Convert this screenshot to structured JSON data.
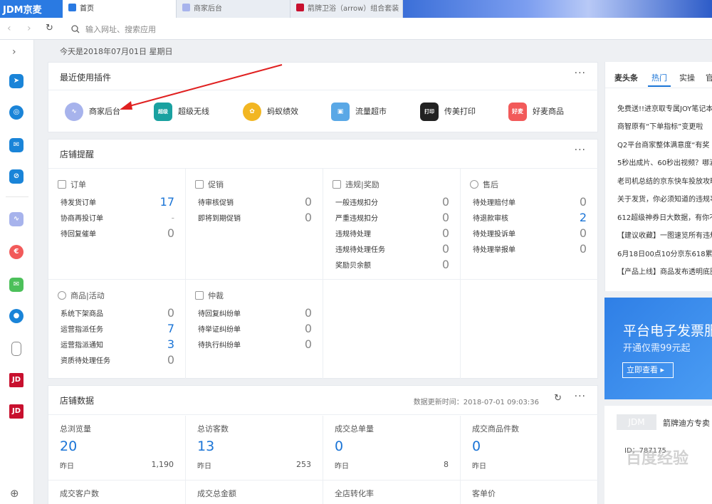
{
  "tabs": {
    "logo": "JDM京麦",
    "items": [
      {
        "label": "首页"
      },
      {
        "label": "商家后台"
      },
      {
        "label": "箭牌卫浴（arrow）组合套装"
      }
    ]
  },
  "address": {
    "placeholder": "输入网址、搜索应用"
  },
  "date_text": "今天是2018年07月01日 星期日",
  "plugins": {
    "title": "最近使用插件",
    "more": "···",
    "items": [
      {
        "label": "商家后台",
        "icon": "chart-icon",
        "color": "#a7b3ec"
      },
      {
        "label": "超级无线",
        "icon": "wireless-icon",
        "color": "#1aa1a0"
      },
      {
        "label": "蚂蚁绩效",
        "icon": "ant-icon",
        "color": "#f2b622"
      },
      {
        "label": "流量超市",
        "icon": "traffic-icon",
        "color": "#5aa8e6"
      },
      {
        "label": "传美打印",
        "icon": "print-icon",
        "color": "#222222"
      },
      {
        "label": "好麦商品",
        "icon": "goods-icon",
        "color": "#f25a5a"
      }
    ]
  },
  "plugin_badges": {
    "wireless": "超级无线",
    "print": "传美打印",
    "goods": "好麦"
  },
  "reminders": {
    "title": "店铺提醒",
    "more": "···",
    "groups": [
      {
        "name": "订单",
        "rows": [
          {
            "label": "待发货订单",
            "value": "17",
            "blue": true
          },
          {
            "label": "协商再投订单",
            "value": "-",
            "blue": false
          },
          {
            "label": "待回复催单",
            "value": "0",
            "blue": false
          }
        ]
      },
      {
        "name": "促销",
        "rows": [
          {
            "label": "待审核促销",
            "value": "0"
          },
          {
            "label": "即将到期促销",
            "value": "0"
          }
        ]
      },
      {
        "name": "违规|奖励",
        "rows": [
          {
            "label": "一般违规扣分",
            "value": "0"
          },
          {
            "label": "严重违规扣分",
            "value": "0"
          },
          {
            "label": "违规待处理",
            "value": "0"
          },
          {
            "label": "违规待处理任务",
            "value": "0"
          },
          {
            "label": "奖励贝余额",
            "value": "0"
          }
        ]
      },
      {
        "name": "售后",
        "rows": [
          {
            "label": "待处理赔付单",
            "value": "0"
          },
          {
            "label": "待退款审核",
            "value": "2"
          },
          {
            "label": "待处理投诉单",
            "value": "0"
          },
          {
            "label": "待处理举报单",
            "value": "0"
          }
        ]
      },
      {
        "name": "商品|活动",
        "rows": [
          {
            "label": "系统下架商品",
            "value": "0"
          },
          {
            "label": "运营指派任务",
            "value": "7"
          },
          {
            "label": "运营指派通知",
            "value": "3"
          },
          {
            "label": "资质待处理任务",
            "value": "0"
          }
        ]
      },
      {
        "name": "仲裁",
        "rows": [
          {
            "label": "待回复纠纷单",
            "value": "0"
          },
          {
            "label": "待举证纠纷单",
            "value": "0"
          },
          {
            "label": "待执行纠纷单",
            "value": "0"
          }
        ]
      }
    ]
  },
  "shop_data": {
    "title": "店铺数据",
    "update_label": "数据更新时间：2018-07-01 09:03:36",
    "more": "···",
    "metrics": [
      {
        "label": "总浏览量",
        "value": "20",
        "yesterday_label": "昨日",
        "yesterday_value": "1,190"
      },
      {
        "label": "总访客数",
        "value": "13",
        "yesterday_label": "昨日",
        "yesterday_value": "253"
      },
      {
        "label": "成交总单量",
        "value": "0",
        "yesterday_label": "昨日",
        "yesterday_value": "8"
      },
      {
        "label": "成交商品件数",
        "value": "0",
        "yesterday_label": "昨日",
        "yesterday_value": ""
      }
    ],
    "metrics2": [
      {
        "label": "成交客户数"
      },
      {
        "label": "成交总金额"
      },
      {
        "label": "全店转化率"
      },
      {
        "label": "客单价"
      }
    ]
  },
  "news": {
    "tabs": [
      "麦头条",
      "热门",
      "实操",
      "官"
    ],
    "items": [
      "免费送!!进京取专属JOY笔记本",
      "商智原有“下单指标”变更啦",
      "Q2平台商家整体满意度“有奖",
      "5秒出成片、60秒出视频？哪滴",
      "老司机总结的京东快车投放攻略",
      "关于发货，你必须知道的违规事",
      "612超级神券日大数据，有你不",
      "【建议收藏】一图速览所有违规",
      "6月18日00点10分京东618累计",
      "【产品上线】商品发布透明底图"
    ]
  },
  "ad": {
    "title": "平台电子发票服",
    "subtitle": "开通仅需99元起",
    "button": "立即查看 ▸"
  },
  "shop_card": {
    "logo": "JDM",
    "name": "箭牌迪方专卖",
    "id": "ID：787175",
    "watermark": "百度经验"
  },
  "colors": {
    "accent": "#1a74d6",
    "tabbar": "#2a7ae2",
    "arrow": "#e02020"
  }
}
